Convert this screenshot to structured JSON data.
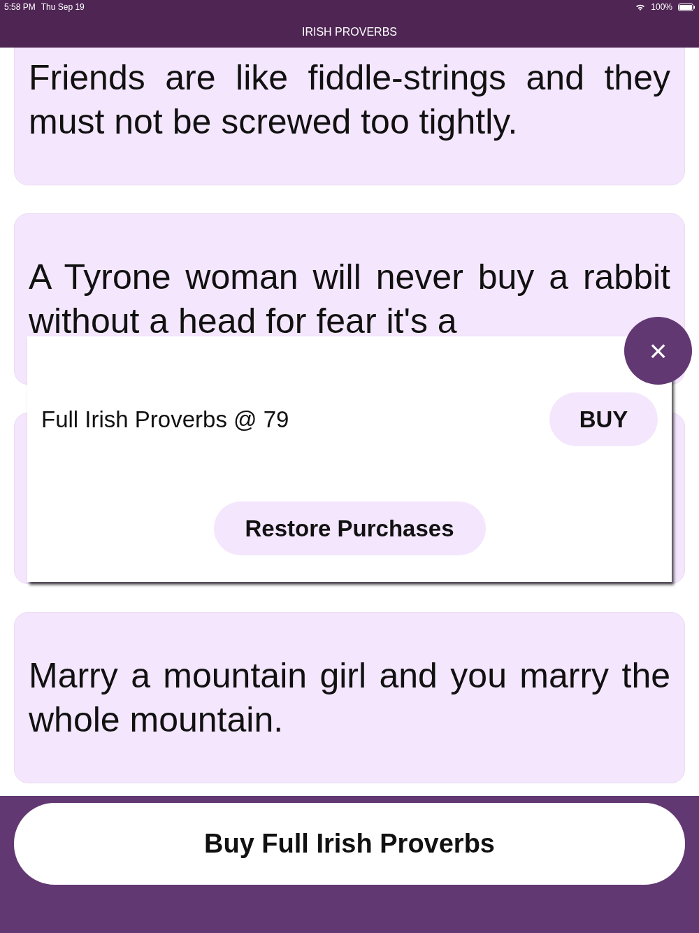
{
  "status_bar": {
    "time": "5:58 PM",
    "date": "Thu Sep 19",
    "battery": "100%"
  },
  "header": {
    "title": "IRISH PROVERBS"
  },
  "cards": [
    {
      "kind": "proverb",
      "text": "Friends are like fiddle-strings and they must not be screwed too tightly."
    },
    {
      "kind": "proverb",
      "text": "A Tyrone woman will never buy a rabbit without a head for fear it's a"
    },
    {
      "kind": "covered"
    },
    {
      "kind": "proverb",
      "text": "Marry a mountain girl and you marry the whole mountain."
    }
  ],
  "popup": {
    "products": [
      {
        "label": "Full Irish Proverbs @ 79",
        "button": "BUY"
      }
    ],
    "restore_button": "Restore Purchases",
    "close": "×"
  },
  "footer": {
    "button": "Buy Full Irish Proverbs"
  }
}
